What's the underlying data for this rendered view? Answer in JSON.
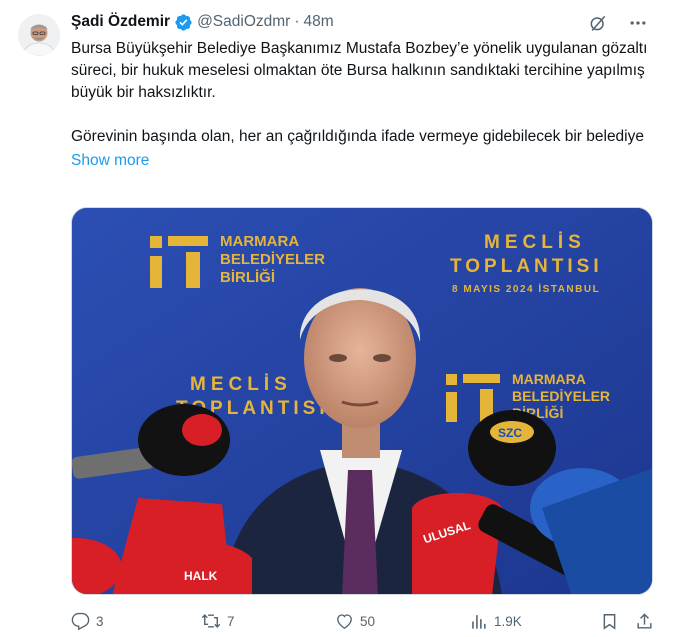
{
  "tweet": {
    "author_name": "Şadi Özdemir",
    "handle": "@SadiOzdmr",
    "separator": "·",
    "time": "48m",
    "text": "Bursa Büyükşehir Belediye Başkanımız Mustafa Bozbey’e yönelik uygulanan gözaltı süreci, bir hukuk meselesi olmaktan öte Bursa halkının sandıktaki tercihine yapılmış büyük bir haksızlıktır.\n\nGörevinin başında olan, her an çağrıldığında ifade vermeye gidebilecek bir belediye",
    "show_more": "Show more"
  },
  "media": {
    "banner_org_line1": "MARMARA",
    "banner_org_line2": "BELEDİYELER",
    "banner_org_line3": "BİRLİĞİ",
    "banner_event_line1": "MECLİS",
    "banner_event_line2": "TOPLANTISI",
    "banner_date": "8 MAYIS 2024  İSTANBUL",
    "mic_labels": [
      "SZC",
      "ULUSAL",
      "HALK"
    ]
  },
  "actions": {
    "replies": "3",
    "reposts": "7",
    "likes": "50",
    "views": "1.9K"
  },
  "icons": {
    "verified": "verified-badge-icon",
    "grok": "grok-icon",
    "more": "more-icon",
    "reply": "reply-icon",
    "repost": "repost-icon",
    "like": "heart-icon",
    "views": "views-icon",
    "bookmark": "bookmark-icon",
    "share": "share-icon"
  },
  "colors": {
    "accent": "#1d9bf0",
    "secondary_text": "#536471",
    "primary_text": "#0f1419",
    "banner_blue": "#2545a8",
    "banner_gold": "#e5b53a"
  }
}
